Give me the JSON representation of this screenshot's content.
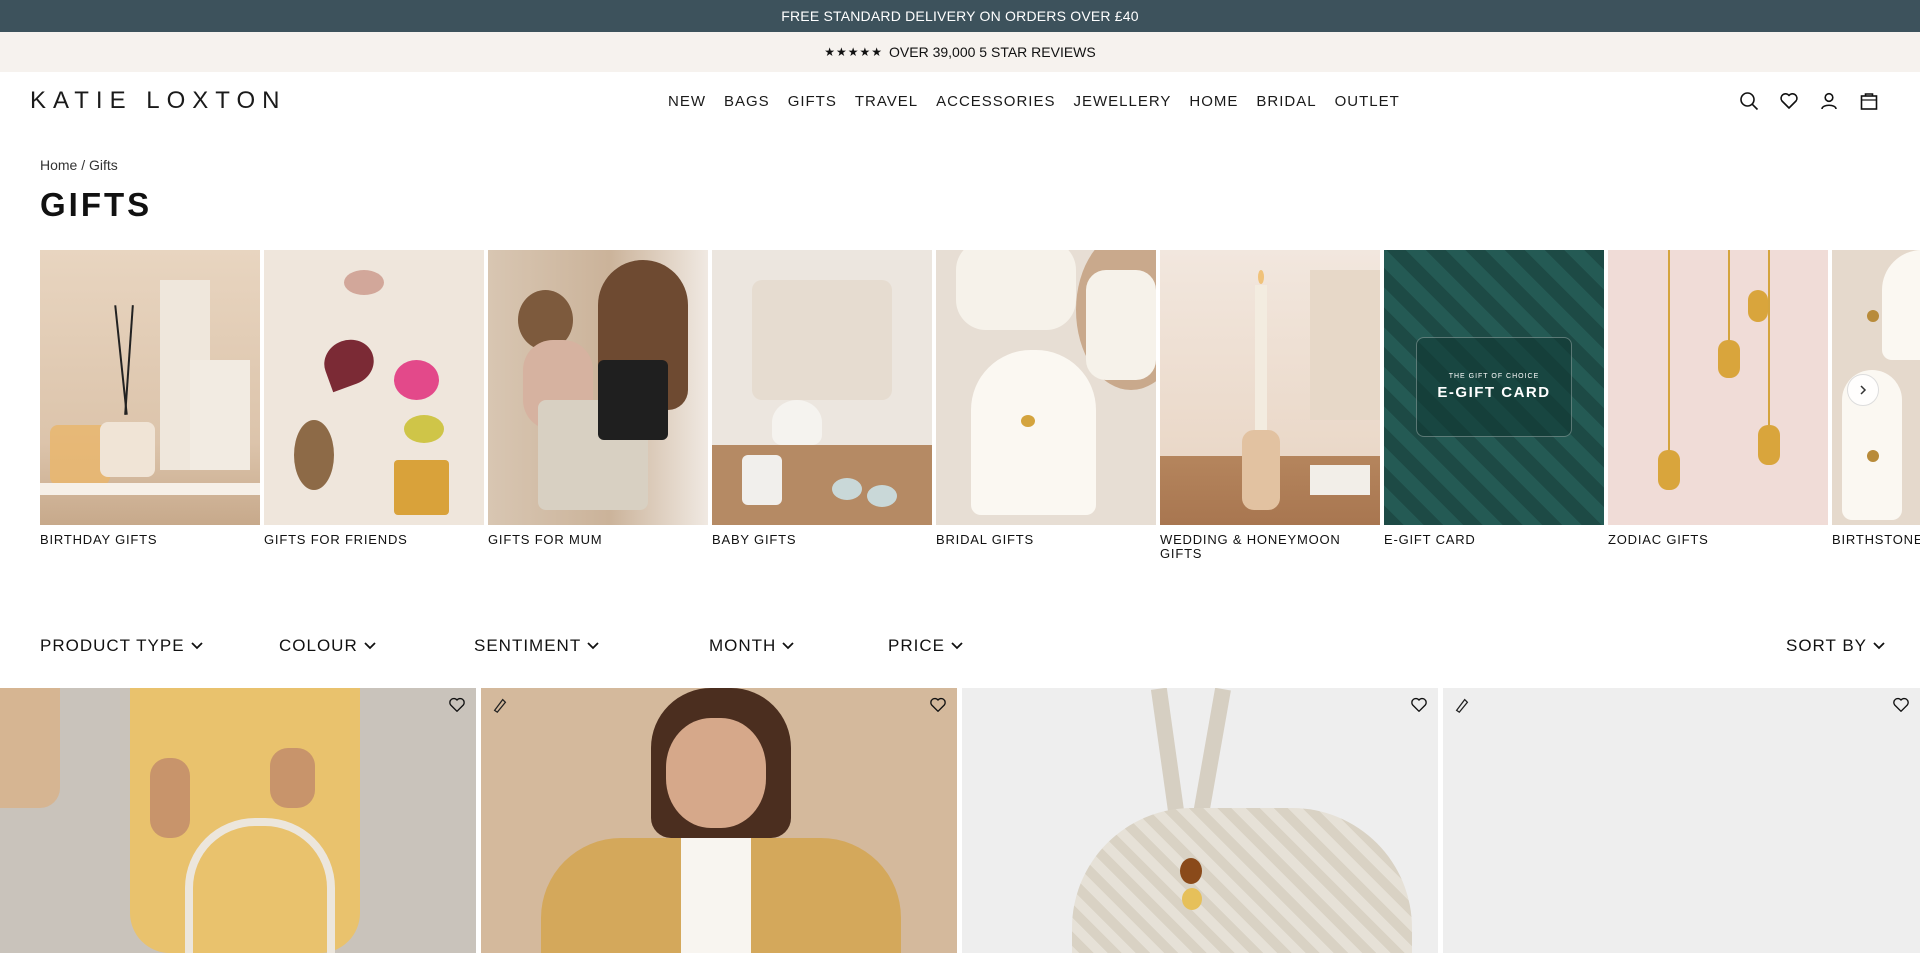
{
  "promo": {
    "delivery": "FREE STANDARD DELIVERY ON ORDERS OVER £40",
    "stars": "★★★★★",
    "reviews": "OVER 39,000 5 STAR REVIEWS"
  },
  "header": {
    "logo": "KATIE LOXTON",
    "nav": [
      "NEW",
      "BAGS",
      "GIFTS",
      "TRAVEL",
      "ACCESSORIES",
      "JEWELLERY",
      "HOME",
      "BRIDAL",
      "OUTLET"
    ],
    "icons": [
      "search-icon",
      "heart-icon",
      "account-icon",
      "bag-icon"
    ]
  },
  "breadcrumb": {
    "home": "Home",
    "separator": " / ",
    "current": "Gifts"
  },
  "page_title": "GIFTS",
  "categories": [
    {
      "label": "BIRTHDAY GIFTS"
    },
    {
      "label": "GIFTS FOR FRIENDS"
    },
    {
      "label": "GIFTS FOR MUM"
    },
    {
      "label": "BABY GIFTS"
    },
    {
      "label": "BRIDAL GIFTS"
    },
    {
      "label": "WEDDING & HONEYMOON GIFTS"
    },
    {
      "label": "E-GIFT CARD",
      "overlay_small": "THE GIFT OF CHOICE",
      "overlay_big": "E-GIFT CARD"
    },
    {
      "label": "ZODIAC GIFTS"
    },
    {
      "label": "BIRTHSTONE"
    }
  ],
  "filters": {
    "product_type": "PRODUCT TYPE",
    "colour": "COLOUR",
    "sentiment": "SENTIMENT",
    "month": "MONTH",
    "price": "PRICE",
    "sort_by": "SORT BY"
  },
  "colors": {
    "promo_bar": "#3d525c",
    "promo_sub": "#f6f2ee",
    "egift": "#1d4a45"
  }
}
